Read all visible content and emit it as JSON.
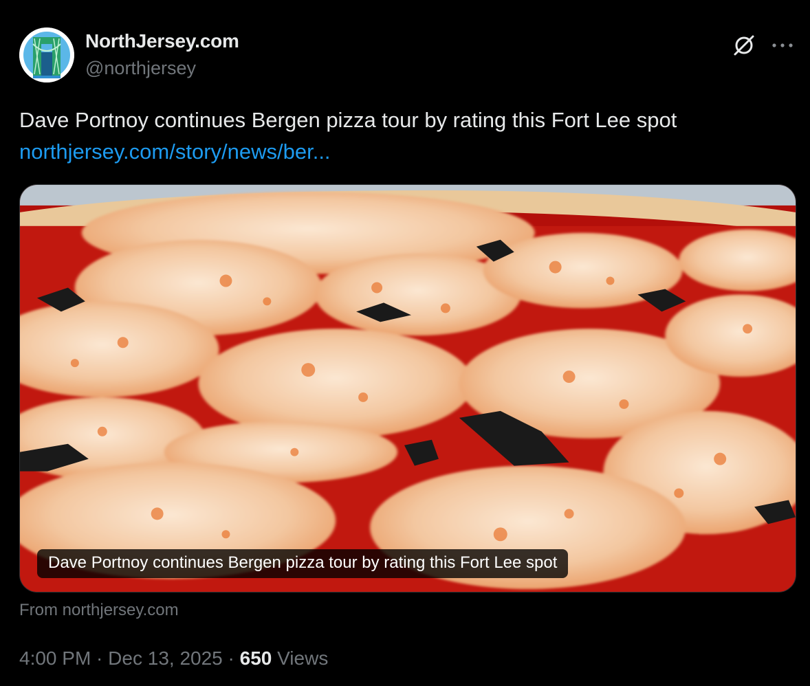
{
  "author": {
    "display_name": "NorthJersey.com",
    "handle": "@northjersey",
    "avatar_icon": "bridge-logo-icon"
  },
  "actions": {
    "grok_icon": "grok-icon",
    "more_icon": "more-icon",
    "more_label": "···"
  },
  "tweet": {
    "text": "Dave Portnoy continues Bergen pizza tour by rating this Fort Lee spot",
    "link": "northjersey.com/story/news/ber..."
  },
  "card": {
    "caption": "Dave Portnoy continues Bergen pizza tour by rating this Fort Lee spot",
    "source": "From northjersey.com"
  },
  "meta": {
    "time": "4:00 PM",
    "sep1": " · ",
    "date": "Dec 13, 2025",
    "sep2": " · ",
    "views_count": "650",
    "views_label": " Views"
  },
  "colors": {
    "background": "#000000",
    "text": "#e7e9ea",
    "muted": "#71767b",
    "link": "#1d9bf0"
  }
}
